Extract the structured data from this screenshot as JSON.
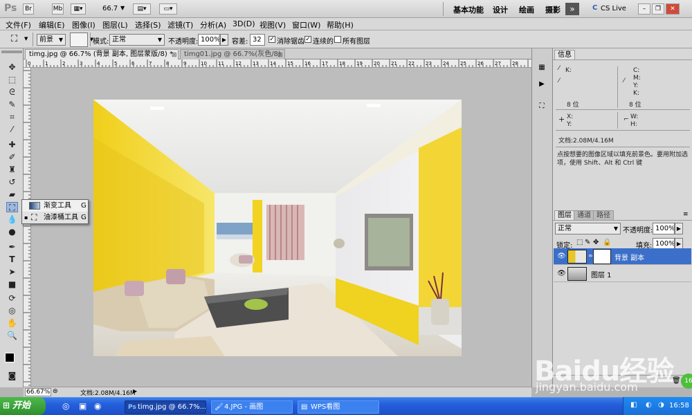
{
  "app": {
    "logo": "Ps",
    "zoom_display": "66.7"
  },
  "workspaces": [
    "基本功能",
    "设计",
    "绘画",
    "摄影"
  ],
  "cs_live": "CS Live",
  "menu": [
    "文件(F)",
    "编辑(E)",
    "图像(I)",
    "图层(L)",
    "选择(S)",
    "滤镜(T)",
    "分析(A)",
    "3D(D)",
    "视图(V)",
    "窗口(W)",
    "帮助(H)"
  ],
  "options": {
    "fill_source": "前景",
    "mode_label": "模式:",
    "mode_value": "正常",
    "opacity_label": "不透明度:",
    "opacity_value": "100%",
    "tolerance_label": "容差:",
    "tolerance_value": "32",
    "antialias_label": "消除锯齿",
    "contiguous_label": "连续的",
    "all_layers_label": "所有图层"
  },
  "doc_tabs": [
    {
      "label": "timg.jpg @ 66.7% (背景 副本, 图层蒙版/8) *",
      "active": true
    },
    {
      "label": "timg01.jpg @ 66.7%(灰色/8)",
      "active": false
    }
  ],
  "ruler_labels": [
    "0",
    "1",
    "2",
    "3",
    "4",
    "5",
    "6",
    "7",
    "8",
    "9",
    "10",
    "11",
    "12",
    "13",
    "14",
    "15",
    "16",
    "17",
    "18",
    "19",
    "20",
    "21",
    "22",
    "23",
    "24",
    "25",
    "26",
    "27",
    "28"
  ],
  "flyout": [
    {
      "label": "渐变工具",
      "key": "G",
      "icon": "gradient-icon"
    },
    {
      "label": "油漆桶工具",
      "key": "G",
      "icon": "paint-bucket-icon"
    }
  ],
  "status": {
    "zoom": "66.67%",
    "doc": "文档:2.08M/4.16M"
  },
  "info_panel": {
    "tab": "信息",
    "k_label": "K:",
    "c_label": "C:",
    "m_label": "M:",
    "y_label": "Y:",
    "k2_label": "K:",
    "bits1": "8 位",
    "bits2": "8 位",
    "x_label": "X:",
    "y2_label": "Y:",
    "w_label": "W:",
    "h_label": "H:",
    "doc": "文档:2.08M/4.16M",
    "hint": "点按想要的图像区域以填充前景色。要用附加选项，使用 Shift、Alt 和 Ctrl 键"
  },
  "layers_panel": {
    "tabs": [
      "图层",
      "通道",
      "路径"
    ],
    "blend_mode": "正常",
    "opacity_label": "不透明度:",
    "opacity_value": "100%",
    "lock_label": "锁定:",
    "fill_label": "填充:",
    "fill_value": "100%",
    "layers": [
      {
        "name": "背景 副本",
        "selected": true
      },
      {
        "name": "图层 1",
        "selected": false
      }
    ]
  },
  "taskbar": {
    "start": "开始",
    "tasks": [
      "timg.jpg @ 66.7%...",
      "4.JPG - 画图",
      "WPS看图"
    ],
    "clock": "16:58"
  },
  "watermark": {
    "brand": "Baidu经验",
    "url": "jingyan.baidu.com",
    "badge": "16"
  },
  "colors": {
    "layer_selected": "#3b6fc9",
    "taskbar": "#245edb",
    "accent_yellow": "#f2d322"
  }
}
